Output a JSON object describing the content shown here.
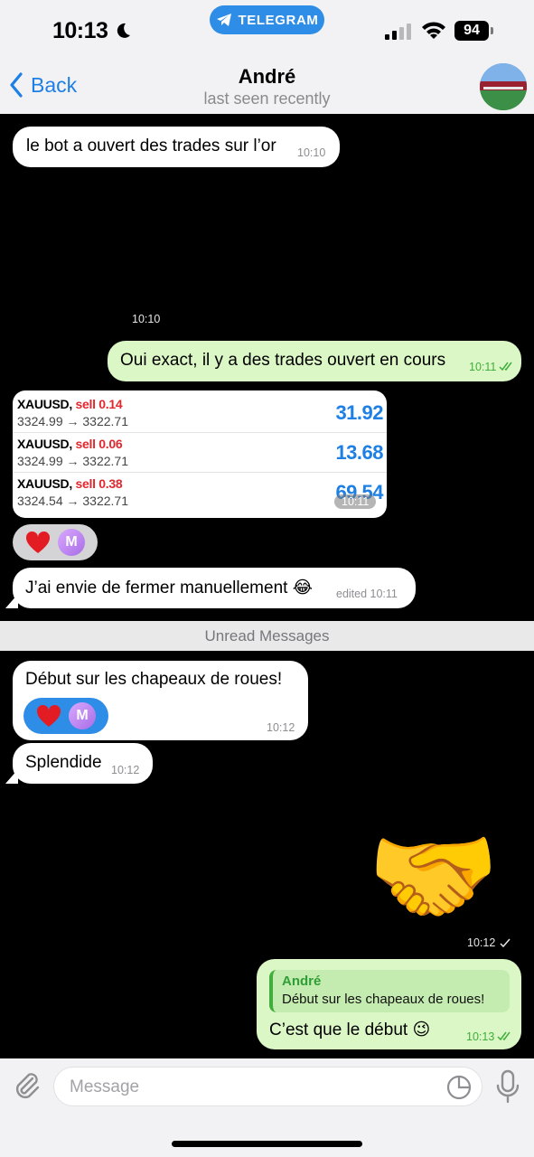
{
  "status_bar": {
    "time": "10:13",
    "banner": "TELEGRAM",
    "battery": "94"
  },
  "header": {
    "back_label": "Back",
    "title": "André",
    "subtitle": "last seen recently"
  },
  "messages": {
    "m1": {
      "text": "le bot a ouvert des trades sur l’or",
      "time": "10:10"
    },
    "m2_sticker": {
      "emoji": "😍",
      "time": "10:10"
    },
    "m3": {
      "text": "Oui exact, il y a des trades ouvert en cours",
      "time": "10:11"
    },
    "m4_trades": {
      "time": "10:11",
      "rows": [
        {
          "symbol": "XAUUSD,",
          "side": "sell 0.14",
          "prices": "3324.99 → 3322.71",
          "pnl": "31.92"
        },
        {
          "symbol": "XAUUSD,",
          "side": "sell 0.06",
          "prices": "3324.99 → 3322.71",
          "pnl": "13.68"
        },
        {
          "symbol": "XAUUSD,",
          "side": "sell 0.38",
          "prices": "3324.54 → 3322.71",
          "pnl": "69.54"
        }
      ],
      "reaction_avatar": "M"
    },
    "m5": {
      "text": "J’ai envie de fermer manuellement 😂",
      "edited": "edited 10:11"
    },
    "unread_label": "Unread Messages",
    "m6": {
      "text": "Début sur les chapeaux de roues!",
      "time": "10:12",
      "reaction_avatar": "M"
    },
    "m7": {
      "text": "Splendide",
      "time": "10:12"
    },
    "m8_sticker": {
      "emoji": "🤝",
      "time": "10:12"
    },
    "m9": {
      "reply_name": "André",
      "reply_text": "Début sur les chapeaux de roues!",
      "text": "C’est que le début 😉",
      "time": "10:13"
    }
  },
  "composer": {
    "placeholder": "Message"
  },
  "colors": {
    "accent": "#1e7fe4",
    "out_bubble": "#dbf7c6",
    "in_bubble": "#ffffff",
    "sell": "#e0282e"
  }
}
